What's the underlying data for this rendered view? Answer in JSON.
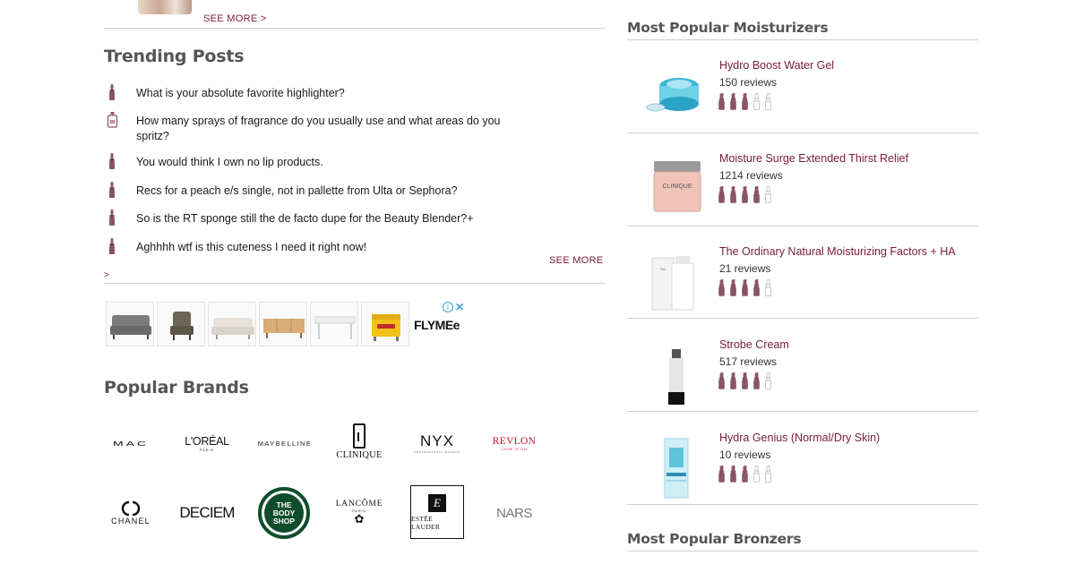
{
  "top": {
    "see_more": "SEE MORE >"
  },
  "trending": {
    "title": "Trending Posts",
    "posts": [
      {
        "icon": "lipstick-icon",
        "text": "What is your absolute favorite highlighter?"
      },
      {
        "icon": "perfume-icon",
        "text": "How many sprays of fragrance do you usually use and what areas do you spritz?"
      },
      {
        "icon": "lipstick-icon",
        "text": "You would think I own no lip products."
      },
      {
        "icon": "lipstick-icon",
        "text": "Recs for a peach e/s single, not in pallette from Ulta or Sephora?"
      },
      {
        "icon": "lipstick-icon",
        "text": "So is the RT sponge still the de facto dupe for the Beauty Blender?+"
      },
      {
        "icon": "lipstick-icon",
        "text": "Aghhhh wtf is this cuteness I need it right now!"
      }
    ],
    "see_more": "SEE MORE",
    "see_more_caret": ">"
  },
  "ad": {
    "brand": "FLYMEe",
    "info": "i",
    "close": "✕"
  },
  "brands": {
    "title": "Popular Brands",
    "items": [
      "MAC",
      "L'ORÉAL",
      "MAYBELLINE",
      "CLINIQUE",
      "NYX",
      "REVLON",
      "CHANEL",
      "DECIEM",
      "THE BODY SHOP",
      "LANCÔME",
      "ESTĒE LAUDER",
      "NARS"
    ],
    "sublabels": {
      "loreal": "PARIS",
      "lancome": "PARIS",
      "revlon": "LOVE IS ON",
      "nyx": "PROFESSIONAL MAKEUP",
      "maybelline": "NEW YORK"
    }
  },
  "moisturizers": {
    "title": "Most Popular Moisturizers",
    "products": [
      {
        "name": "Hydro Boost Water Gel",
        "reviews": "150 reviews",
        "rating": 3
      },
      {
        "name": "Moisture Surge Extended Thirst Relief",
        "reviews": "1214 reviews",
        "rating": 4
      },
      {
        "name": "The Ordinary Natural Moisturizing Factors + HA",
        "reviews": "21 reviews",
        "rating": 4
      },
      {
        "name": "Strobe Cream",
        "reviews": "517 reviews",
        "rating": 4
      },
      {
        "name": "Hydra Genius (Normal/Dry Skin)",
        "reviews": "10 reviews",
        "rating": 3
      }
    ]
  },
  "bronzers": {
    "title": "Most Popular Bronzers"
  },
  "colors": {
    "accent": "#7a1a3c",
    "lip_filled": "#8a5468",
    "lip_empty": "#bbbbbb",
    "rule": "#cfcfcf",
    "heading": "#555555"
  }
}
